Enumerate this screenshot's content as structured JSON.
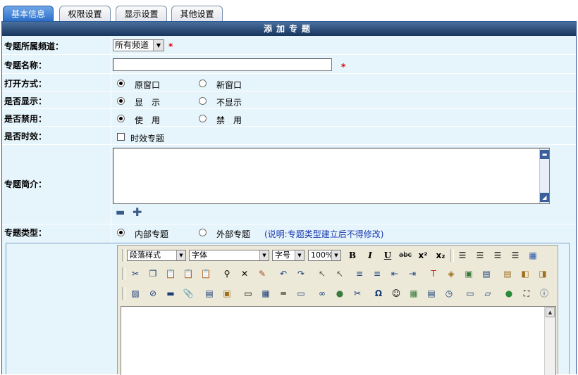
{
  "tabs": [
    {
      "label": "基本信息",
      "active": true
    },
    {
      "label": "权限设置",
      "active": false
    },
    {
      "label": "显示设置",
      "active": false
    },
    {
      "label": "其他设置",
      "active": false
    }
  ],
  "form": {
    "title": "添加专题",
    "required_mark": "*",
    "channel": {
      "label": "专题所属频道：",
      "selected": "所有频道"
    },
    "name": {
      "label": "专题名称：",
      "value": ""
    },
    "open_mode": {
      "label": "打开方式：",
      "options": [
        "原窗口",
        "新窗口"
      ],
      "selected": "原窗口"
    },
    "display": {
      "label": "是否显示：",
      "options": [
        "显　示",
        "不显示"
      ],
      "selected": "显　示"
    },
    "disable": {
      "label": "是否禁用：",
      "options": [
        "使　用",
        "禁　用"
      ],
      "selected": "使　用"
    },
    "timed": {
      "label": "是否时效：",
      "checkbox_label": "时效专题",
      "checked": false
    },
    "intro": {
      "label": "专题简介：",
      "value": ""
    },
    "type": {
      "label": "专题类型：",
      "options": [
        "内部专题",
        "外部专题"
      ],
      "selected": "内部专题",
      "note": "(说明:专题类型建立后不得修改)"
    }
  },
  "editor": {
    "paragraph_style": "段落样式",
    "font": "字体",
    "font_size": "字号",
    "zoom": "100%"
  },
  "colors": {
    "tab_active": "#2c6fc9",
    "title_bar": "#17355e",
    "form_bg": "#e6f4fb",
    "required": "#e00000",
    "note": "#1a3ab0"
  }
}
